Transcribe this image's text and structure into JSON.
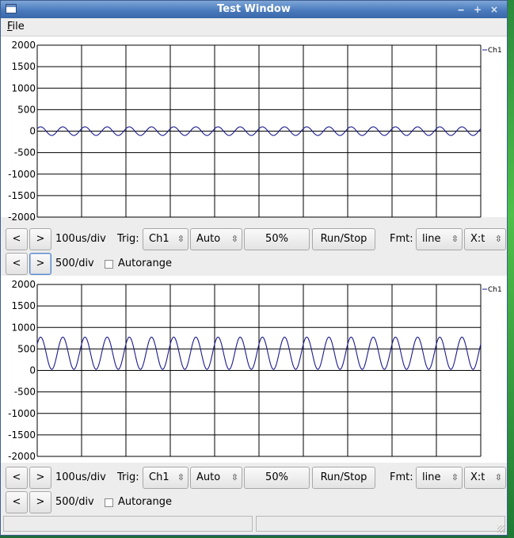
{
  "window": {
    "title": "Test Window",
    "minimize": "‒",
    "maximize": "+",
    "close": "×"
  },
  "menu": {
    "file_mnemonic": "F",
    "file_rest": "ile"
  },
  "plots": [
    {
      "chart_data": {
        "type": "line",
        "yticks": [
          "2000",
          "1500",
          "1000",
          "500",
          "0",
          "-500",
          "-1000",
          "-1500",
          "-2000"
        ],
        "ylim": [
          -2000,
          2000
        ],
        "grid": true,
        "legend": "top-right",
        "series": [
          {
            "name": "Ch1",
            "color": "#1a1a8c",
            "offset": 0,
            "amplitude": 100,
            "cycles": 20
          }
        ]
      }
    },
    {
      "chart_data": {
        "type": "line",
        "yticks": [
          "2000",
          "1500",
          "1000",
          "500",
          "0",
          "-500",
          "-1000",
          "-1500",
          "-2000"
        ],
        "ylim": [
          -2000,
          2000
        ],
        "grid": true,
        "legend": "top-right",
        "series": [
          {
            "name": "Ch1",
            "color": "#1a1a8c",
            "offset": 400,
            "amplitude": 375,
            "cycles": 20
          }
        ]
      }
    }
  ],
  "controls": [
    {
      "prev": "<",
      "next": ">",
      "timediv": "100us/div",
      "trig_label": "Trig:",
      "trig_channel": "Ch1",
      "trig_mode": "Auto",
      "trig_level": "50%",
      "runstop": "Run/Stop",
      "fmt_label": "Fmt:",
      "fmt_value": "line",
      "fmt_axis": "X:t",
      "vprev": "<",
      "vnext": ">",
      "vdiv": "500/div",
      "autorange": "Autorange"
    },
    {
      "prev": "<",
      "next": ">",
      "timediv": "100us/div",
      "trig_label": "Trig:",
      "trig_channel": "Ch1",
      "trig_mode": "Auto",
      "trig_level": "50%",
      "runstop": "Run/Stop",
      "fmt_label": "Fmt:",
      "fmt_value": "line",
      "fmt_axis": "X:t",
      "vprev": "<",
      "vnext": ">",
      "vdiv": "500/div",
      "autorange": "Autorange"
    }
  ],
  "status": {
    "left": "",
    "right": ""
  }
}
